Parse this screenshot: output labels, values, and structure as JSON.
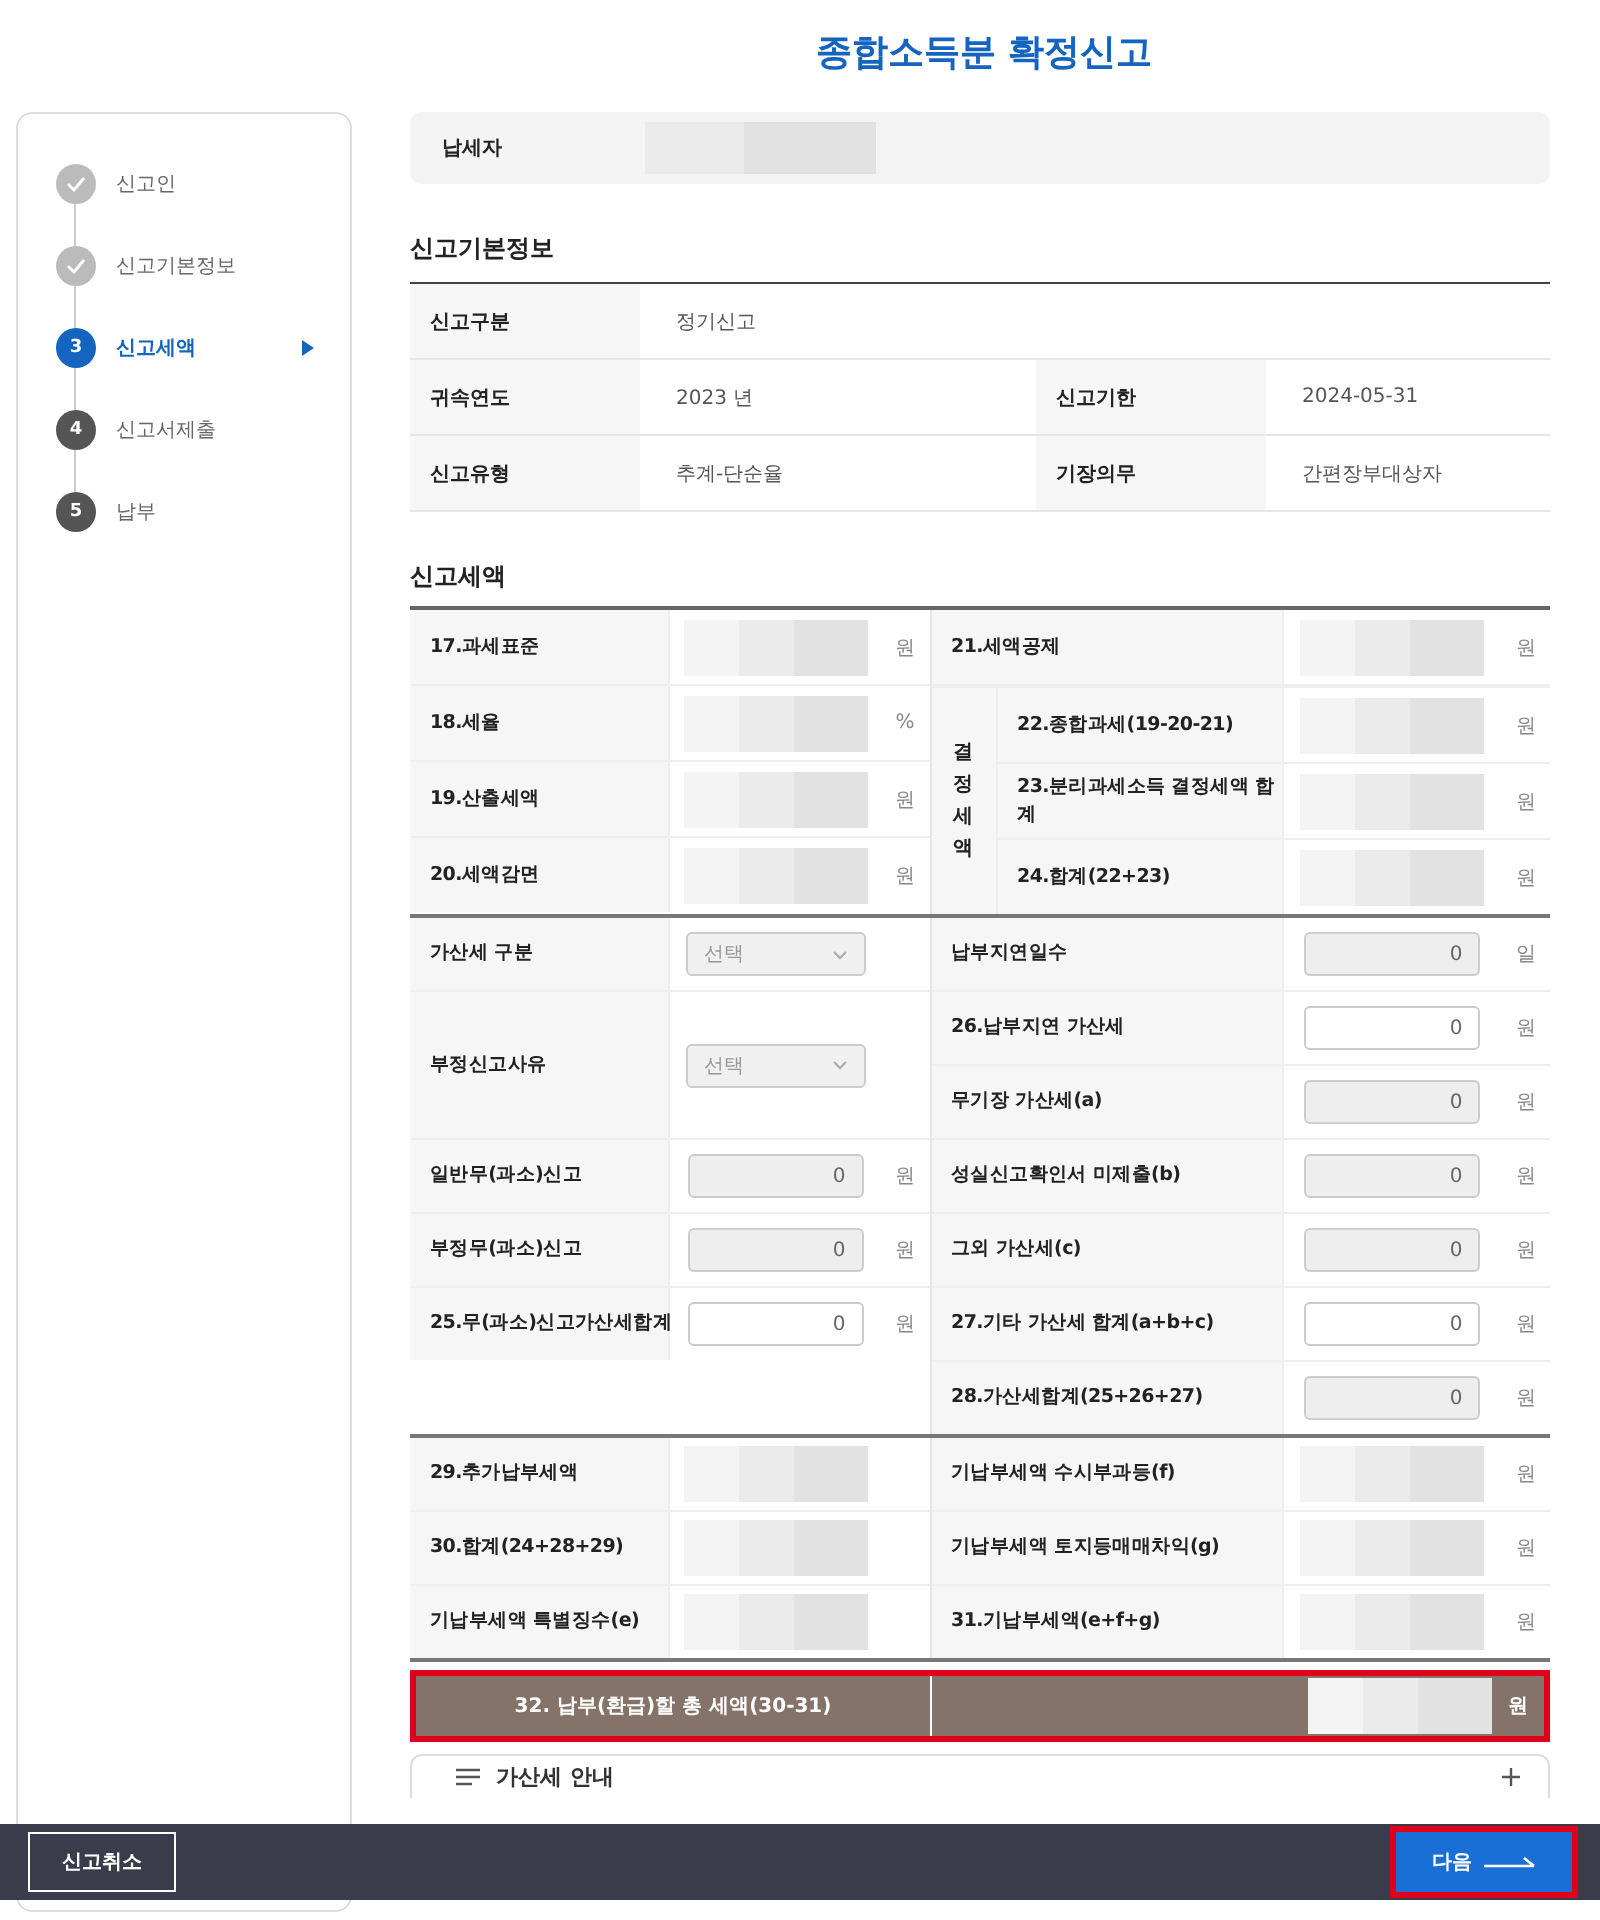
{
  "page_title": "종합소득분 확정신고",
  "steps": [
    {
      "label": "신고인",
      "completed": true,
      "selected": false
    },
    {
      "label": "신고기본정보",
      "completed": true,
      "selected": false
    },
    {
      "number": "3",
      "label": "신고세액",
      "completed": false,
      "selected": true
    },
    {
      "number": "4",
      "label": "신고서제출",
      "completed": false,
      "selected": false
    },
    {
      "number": "5",
      "label": "납부",
      "completed": false,
      "selected": false
    }
  ],
  "taxpayer": {
    "label": "납세자",
    "value": {
      "kind": "redacted"
    }
  },
  "basic_info": {
    "heading": "신고기본정보",
    "rows": [
      [
        {
          "label": "신고구분",
          "value": "정기신고"
        }
      ],
      [
        {
          "label": "귀속연도",
          "value": "2023 년"
        },
        {
          "label": "신고기한",
          "value": "2024-05-31"
        }
      ],
      [
        {
          "label": "신고유형",
          "value": "추계-단순율"
        },
        {
          "label": "기장의무",
          "value": "간편장부대상자"
        }
      ]
    ]
  },
  "tax": {
    "heading": "신고세액",
    "blocks": [
      {
        "left": [
          {
            "label": "17.과세표준",
            "field": {
              "kind": "redacted"
            },
            "unit": "원"
          },
          {
            "label": "18.세율",
            "field": {
              "kind": "redacted"
            },
            "unit": "%"
          },
          {
            "label": "19.산출세액",
            "field": {
              "kind": "redacted"
            },
            "unit": "원"
          },
          {
            "label": "20.세액감면",
            "field": {
              "kind": "redacted"
            },
            "unit": "원"
          }
        ],
        "right": [
          {
            "kind": "row",
            "label": "21.세액공제",
            "field": {
              "kind": "redacted"
            },
            "unit": "원"
          },
          {
            "kind": "group",
            "label": "결정세액",
            "items": [
              {
                "label": "22.종합과세(19-20-21)",
                "field": {
                  "kind": "redacted"
                },
                "unit": "원"
              },
              {
                "label": "23.분리과세소득 결정세액 합계",
                "field": {
                  "kind": "redacted"
                },
                "unit": "원"
              },
              {
                "label": "24.합계(22+23)",
                "field": {
                  "kind": "redacted"
                },
                "unit": "원"
              }
            ]
          }
        ]
      },
      {
        "left": [
          {
            "label": "가산세 구분",
            "field": {
              "kind": "select",
              "placeholder": "선택"
            },
            "tall": false
          },
          {
            "label": "부정신고사유",
            "field": {
              "kind": "select",
              "placeholder": "선택"
            },
            "tall": true
          },
          {
            "label": "일반무(과소)신고",
            "field": {
              "kind": "readonly",
              "value": "0"
            },
            "unit": "원",
            "tall": false
          },
          {
            "label": "부정무(과소)신고",
            "field": {
              "kind": "readonly",
              "value": "0"
            },
            "unit": "원",
            "tall": false
          },
          {
            "label": "25.무(과소)신고가산세합계",
            "field": {
              "kind": "input",
              "value": "0"
            },
            "unit": "원",
            "tall": false
          }
        ],
        "right": [
          {
            "kind": "row",
            "label": "납부지연일수",
            "field": {
              "kind": "readonly",
              "value": "0"
            },
            "unit": "일"
          },
          {
            "kind": "row",
            "label": "26.납부지연 가산세",
            "field": {
              "kind": "input",
              "value": "0"
            },
            "unit": "원"
          },
          {
            "kind": "row",
            "label": "무기장 가산세(a)",
            "field": {
              "kind": "readonly",
              "value": "0"
            },
            "unit": "원"
          },
          {
            "kind": "row",
            "label": "성실신고확인서 미제출(b)",
            "field": {
              "kind": "readonly",
              "value": "0"
            },
            "unit": "원"
          },
          {
            "kind": "row",
            "label": "그외 가산세(c)",
            "field": {
              "kind": "readonly",
              "value": "0"
            },
            "unit": "원"
          },
          {
            "kind": "row",
            "label": "27.기타 가산세 합계(a+b+c)",
            "field": {
              "kind": "input",
              "value": "0"
            },
            "unit": "원"
          },
          {
            "kind": "row",
            "label": "28.가산세합계(25+26+27)",
            "field": {
              "kind": "readonly",
              "value": "0"
            },
            "unit": "원"
          }
        ]
      },
      {
        "left": [
          {
            "label": "29.추가납부세액",
            "field": {
              "kind": "redacted"
            }
          },
          {
            "label": "30.합계(24+28+29)",
            "field": {
              "kind": "redacted"
            }
          },
          {
            "label": "기납부세액 특별징수(e)",
            "field": {
              "kind": "redacted"
            }
          }
        ],
        "right": [
          {
            "kind": "row",
            "label": "기납부세액 수시부과등(f)",
            "field": {
              "kind": "redacted"
            },
            "unit": "원"
          },
          {
            "kind": "row",
            "label": "기납부세액 토지등매매차익(g)",
            "field": {
              "kind": "redacted"
            },
            "unit": "원"
          },
          {
            "kind": "row",
            "label": "31.기납부세액(e+f+g)",
            "field": {
              "kind": "redacted"
            },
            "unit": "원"
          }
        ]
      }
    ],
    "total": {
      "label": "32. 납부(환급)할 총 세액(30-31)",
      "field": {
        "kind": "redacted"
      },
      "unit": "원",
      "highlighted": true
    }
  },
  "accordion": {
    "title": "가산세 안내",
    "expanded": false
  },
  "footer": {
    "cancel": "신고취소",
    "next": {
      "label": "다음",
      "highlighted": true
    }
  }
}
